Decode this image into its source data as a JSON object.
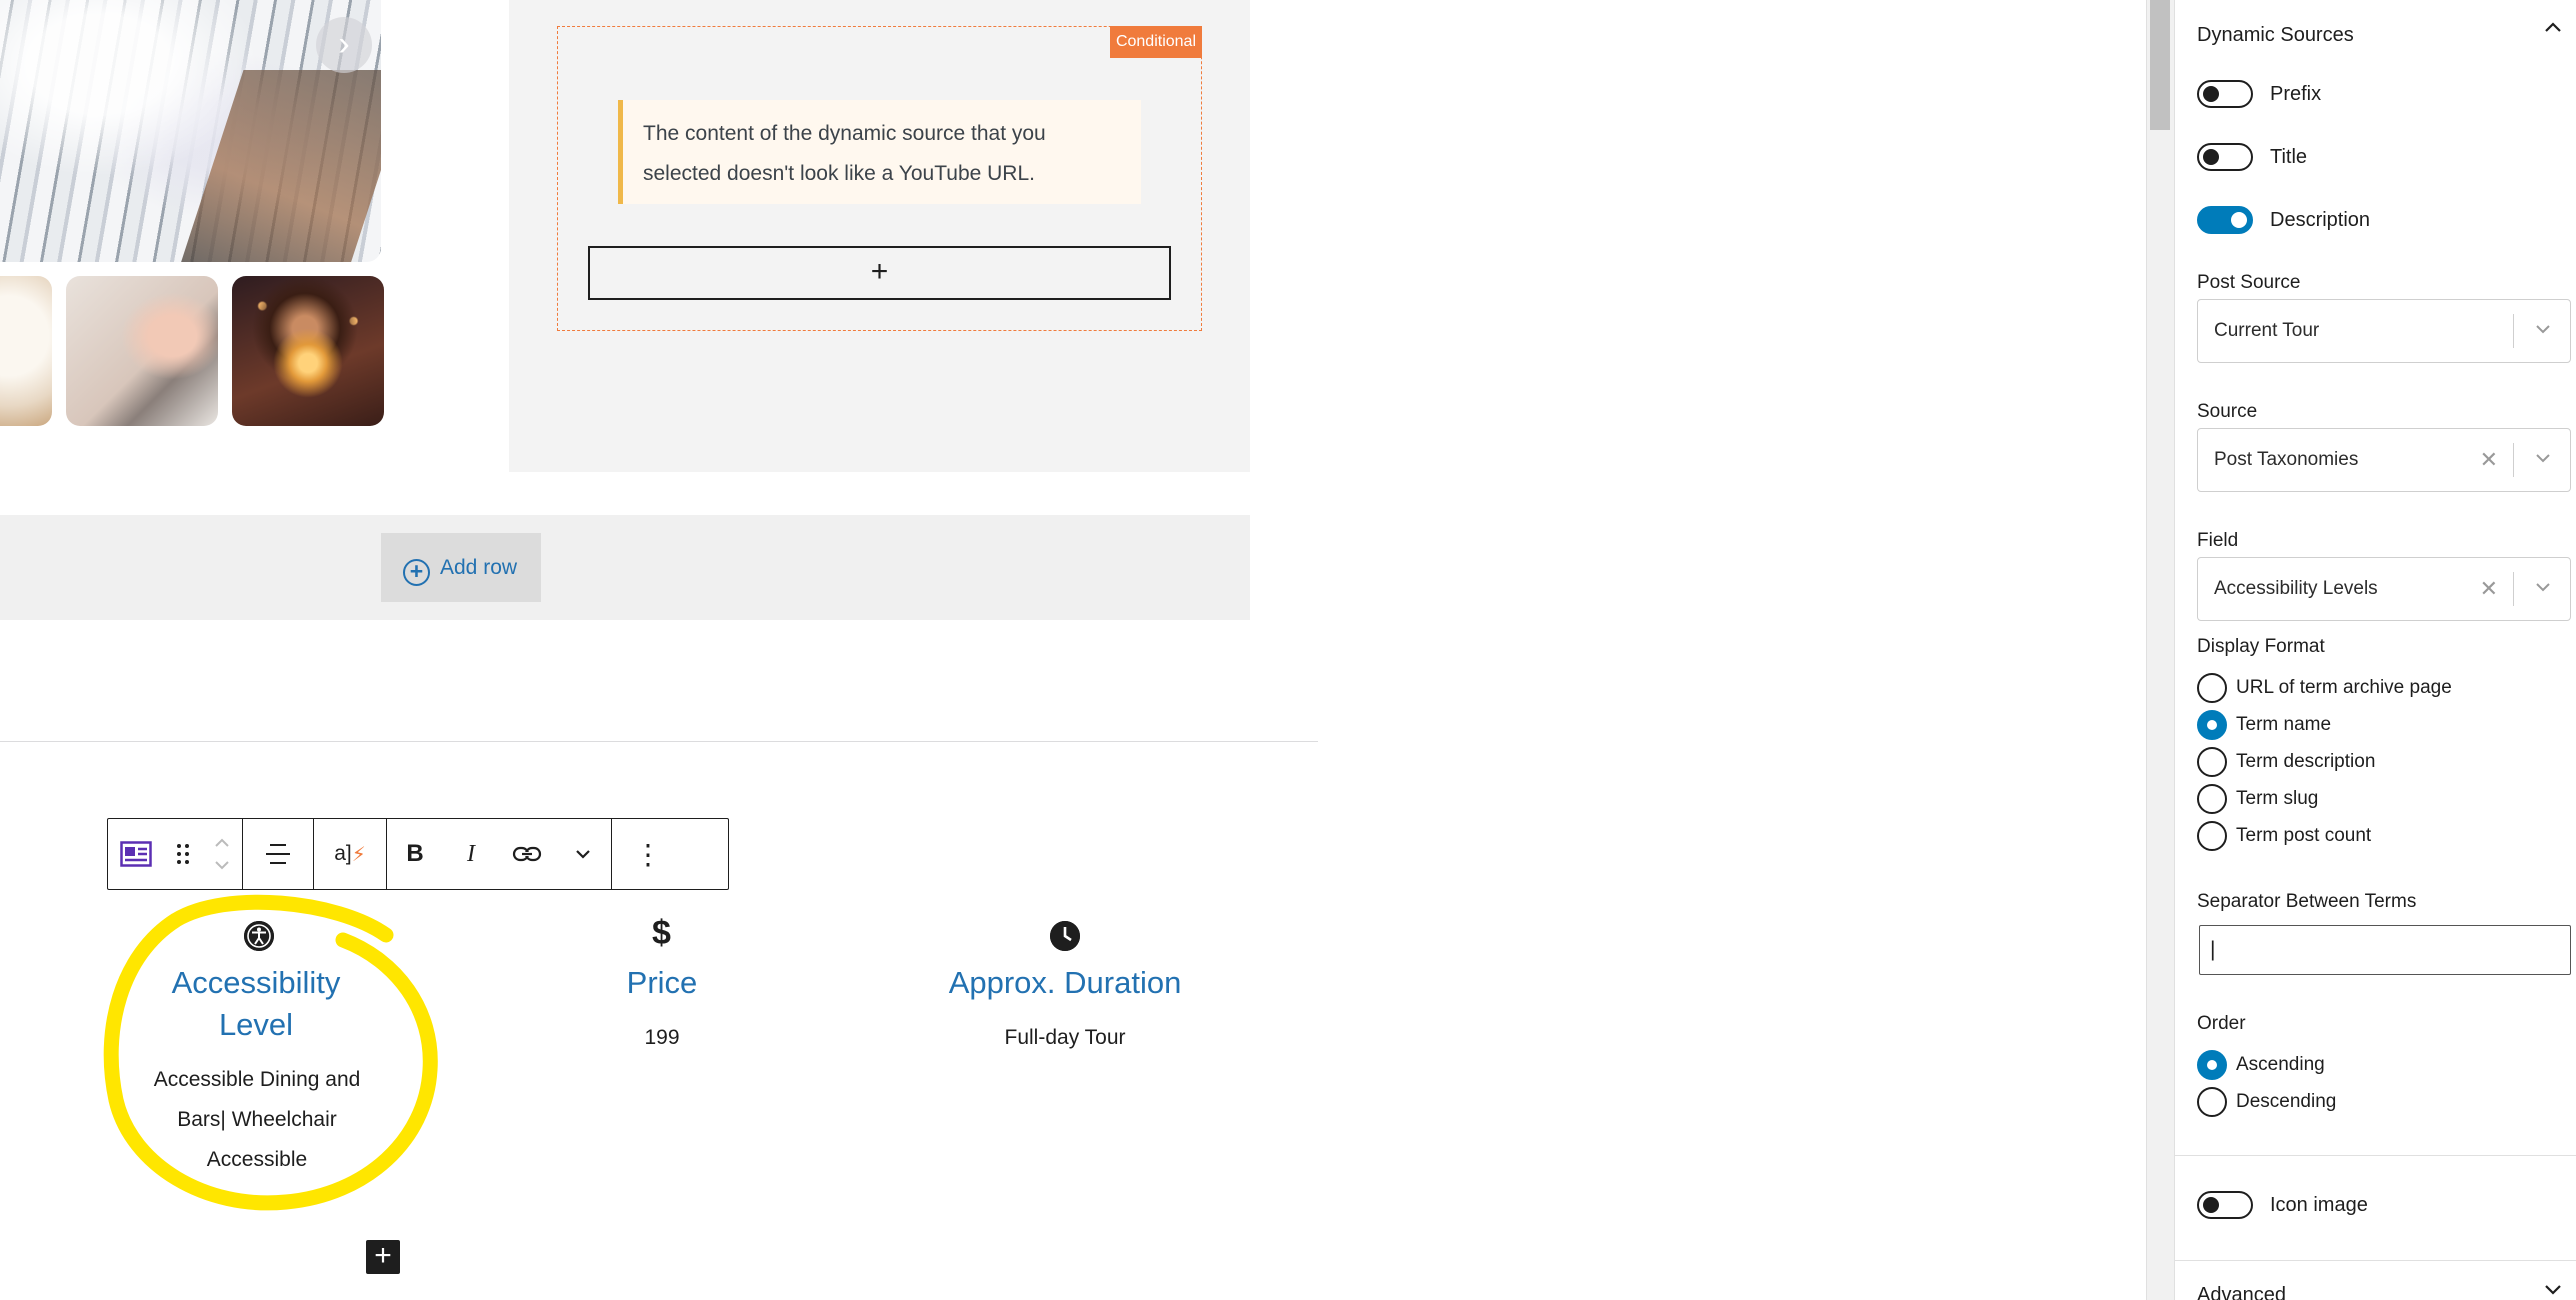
{
  "gallery": {
    "next_icon": "chevron-right-icon",
    "next_glyph": "›"
  },
  "conditional": {
    "badge": "Conditional",
    "notice": "The content of the dynamic source that you selected doesn't look like a YouTube URL.",
    "appender_glyph": "+"
  },
  "add_row": {
    "label": "Add row",
    "plus_glyph": "+"
  },
  "toolbar": {
    "icons": [
      "block-type-icon",
      "drag-handle-icon",
      "move-up-icon",
      "move-down-icon",
      "align-icon",
      "dynamic-text-icon",
      "bold-icon",
      "italic-icon",
      "link-icon",
      "more-chevron-icon",
      "options-icon"
    ],
    "dynamic_glyph": "a]",
    "bold_glyph": "B",
    "italic_glyph": "I",
    "options_glyph": "⋮"
  },
  "info": {
    "accessibility": {
      "icon": "accessibility-icon",
      "title_line1": "Accessibility",
      "title_line2": "Level",
      "line1": "Accessible Dining and",
      "line2": "Bars| Wheelchair",
      "line3": "Accessible"
    },
    "price": {
      "icon": "dollar-icon",
      "icon_glyph": "$",
      "title": "Price",
      "value": "199"
    },
    "duration": {
      "icon": "clock-icon",
      "title": "Approx. Duration",
      "value": "Full-day Tour"
    }
  },
  "block_plus": "+",
  "sidebar": {
    "title": "Dynamic Sources",
    "toggles": [
      {
        "label": "Prefix",
        "on": false
      },
      {
        "label": "Title",
        "on": false
      },
      {
        "label": "Description",
        "on": true
      }
    ],
    "post_source": {
      "label": "Post Source",
      "value": "Current Tour"
    },
    "source": {
      "label": "Source",
      "value": "Post Taxonomies"
    },
    "field": {
      "label": "Field",
      "value": "Accessibility Levels"
    },
    "display_format": {
      "label": "Display Format",
      "options": [
        "URL of term archive page",
        "Term name",
        "Term description",
        "Term slug",
        "Term post count"
      ],
      "selected": "Term name"
    },
    "separator": {
      "label": "Separator Between Terms",
      "value": "|"
    },
    "order": {
      "label": "Order",
      "options": [
        "Ascending",
        "Descending"
      ],
      "selected": "Ascending"
    },
    "icon_image": {
      "label": "Icon image",
      "on": false
    },
    "advanced": "Advanced"
  },
  "colors": {
    "accent": "#007cba",
    "link": "#2271b1",
    "conditional": "#f07b3c",
    "highlight": "#ffe600"
  }
}
